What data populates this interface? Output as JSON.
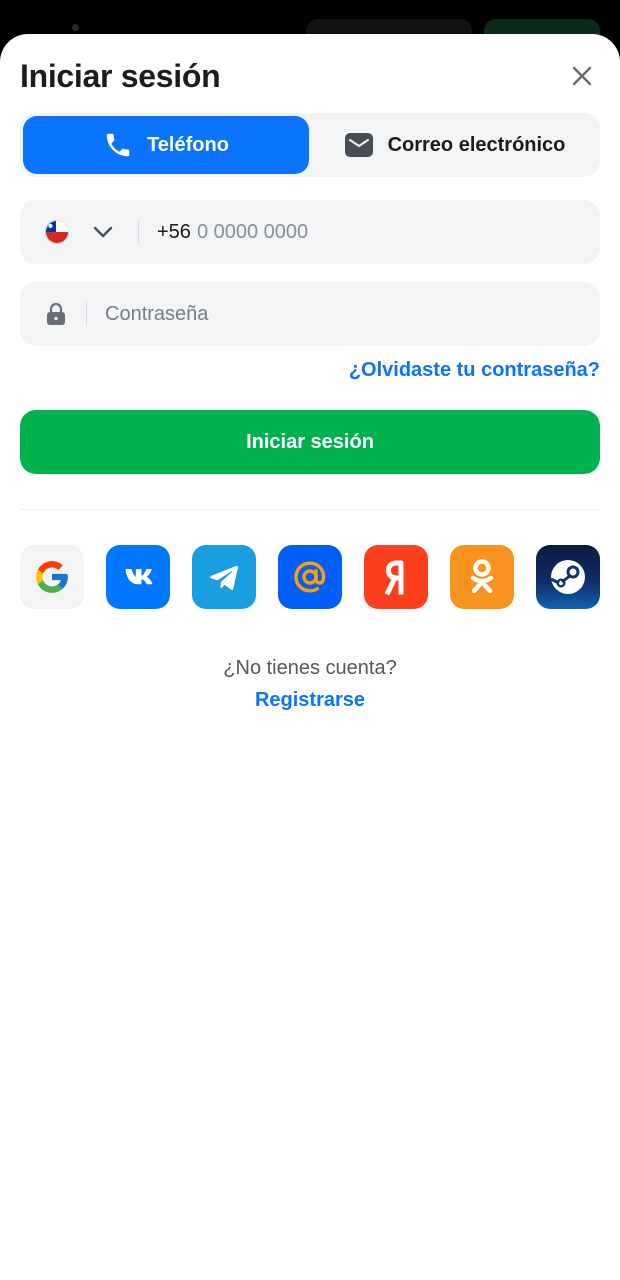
{
  "header": {
    "title": "Iniciar sesión"
  },
  "tabs": [
    {
      "label": "Teléfono",
      "icon": "phone-icon",
      "active": true
    },
    {
      "label": "Correo electrónico",
      "icon": "mail-icon",
      "active": false
    }
  ],
  "phone_field": {
    "country": "Chile",
    "prefix": "+56",
    "placeholder": "0 0000 0000"
  },
  "password_field": {
    "placeholder": "Contraseña"
  },
  "forgot_link": "¿Olvidaste tu contraseña?",
  "submit_label": "Iniciar sesión",
  "social": [
    "google",
    "vk",
    "telegram",
    "mail-ru",
    "yandex",
    "odnoklassniki",
    "steam"
  ],
  "footer": {
    "question": "¿No tienes cuenta?",
    "register_label": "Registrarse"
  },
  "colors": {
    "primary": "#0a74ff",
    "success": "#00b24e",
    "field_bg": "#f3f4f6"
  }
}
